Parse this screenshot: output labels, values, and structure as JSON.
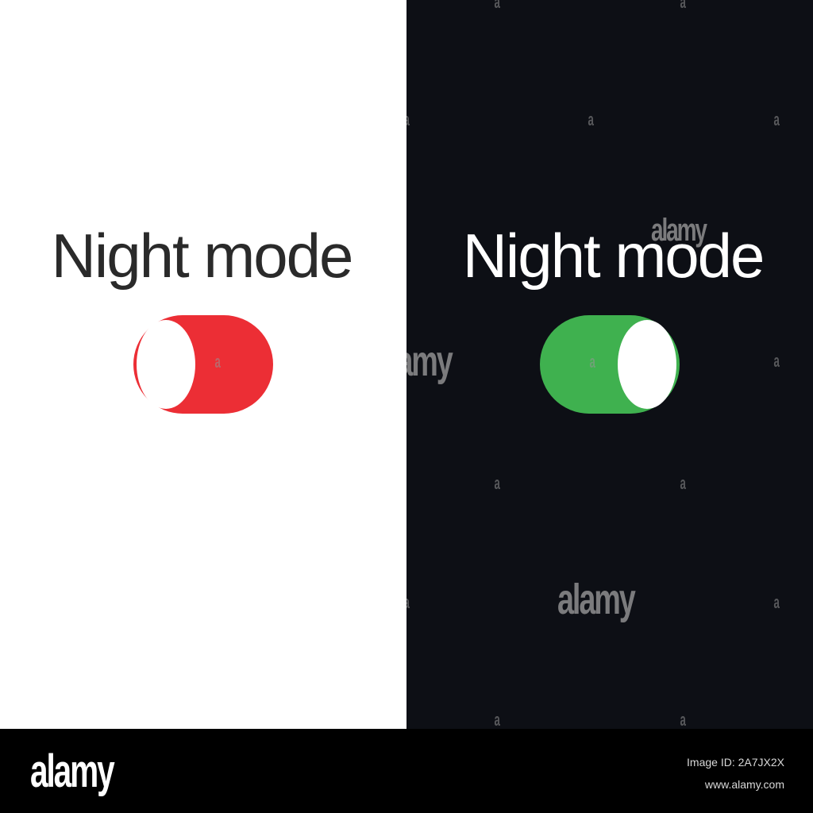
{
  "light_panel": {
    "title": "Night mode",
    "toggle": {
      "state": "off",
      "color": "#ec2e35",
      "knob_color": "#ffffff"
    },
    "background": "#ffffff"
  },
  "dark_panel": {
    "title": "Night mode",
    "toggle": {
      "state": "on",
      "color": "#3fb14f",
      "knob_color": "#ffffff"
    },
    "background": "#0d0f15"
  },
  "watermark": {
    "tile_glyph": "a",
    "logo_text": "alamy"
  },
  "footer": {
    "logo": "alamy",
    "image_id": "Image ID: 2A7JX2X",
    "url": "www.alamy.com"
  }
}
